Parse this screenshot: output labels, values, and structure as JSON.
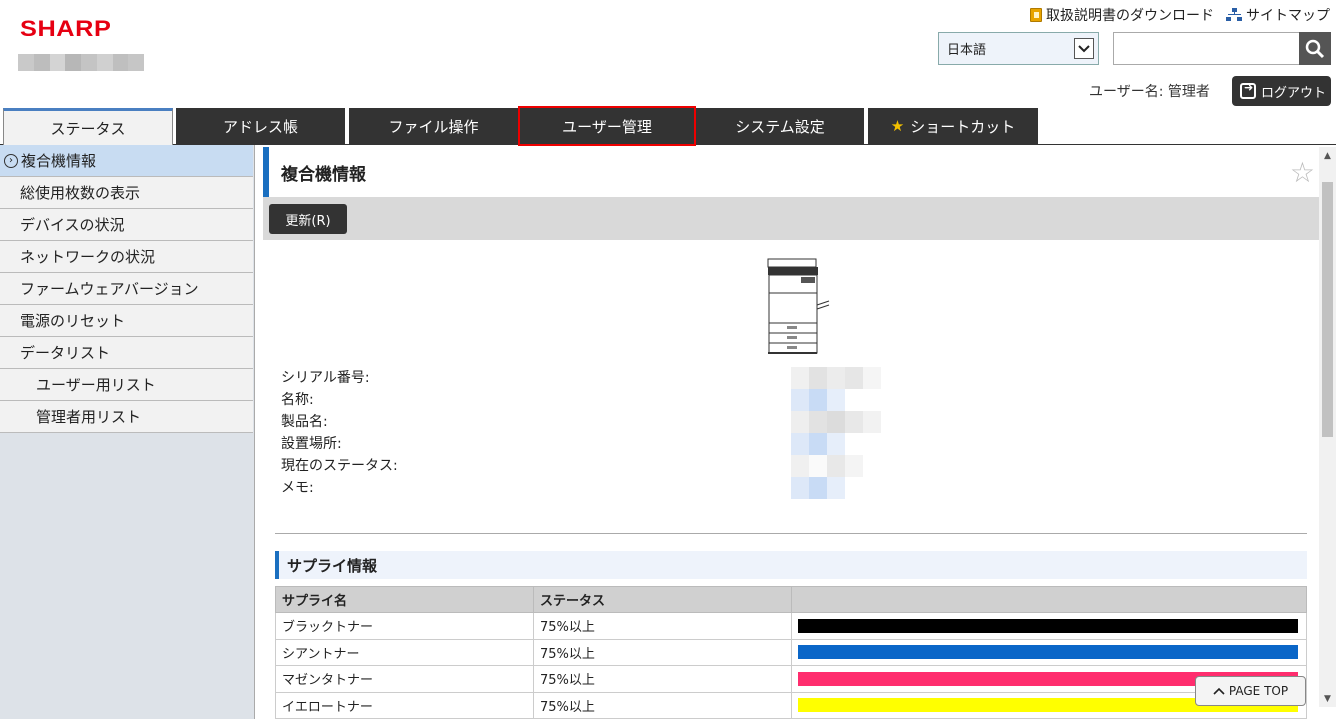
{
  "header": {
    "logo": "SHARP",
    "manual_link": "取扱説明書のダウンロード",
    "sitemap_link": "サイトマップ",
    "language": "日本語",
    "search_placeholder": "",
    "user_label": "ユーザー名: 管理者",
    "logout": "ログアウト"
  },
  "tabs": [
    "ステータス",
    "アドレス帳",
    "ファイル操作",
    "ユーザー管理",
    "システム設定",
    "ショートカット"
  ],
  "sidebar": [
    {
      "label": "複合機情報"
    },
    {
      "label": "総使用枚数の表示"
    },
    {
      "label": "デバイスの状況"
    },
    {
      "label": "ネットワークの状況"
    },
    {
      "label": "ファームウェアバージョン"
    },
    {
      "label": "電源のリセット"
    },
    {
      "label": "データリスト"
    },
    {
      "label": "ユーザー用リスト"
    },
    {
      "label": "管理者用リスト"
    }
  ],
  "main": {
    "title": "複合機情報",
    "refresh": "更新(R)",
    "info_labels": [
      "シリアル番号:",
      "名称:",
      "製品名:",
      "設置場所:",
      "現在のステータス:",
      "メモ:"
    ],
    "supply_title": "サプライ情報",
    "table_headers": [
      "サプライ名",
      "ステータス"
    ],
    "supplies": [
      {
        "name": "ブラックトナー",
        "status": "75%以上",
        "color": "#000000"
      },
      {
        "name": "シアントナー",
        "status": "75%以上",
        "color": "#0a66c8"
      },
      {
        "name": "マゼンタトナー",
        "status": "75%以上",
        "color": "#ff2d6e"
      },
      {
        "name": "イエロートナー",
        "status": "75%以上",
        "color": "#ffff00"
      }
    ],
    "page_top": "PAGE TOP"
  },
  "colors": {
    "accent": "#1a6fc0",
    "brand": "#e60012",
    "tab_dark": "#333333"
  }
}
